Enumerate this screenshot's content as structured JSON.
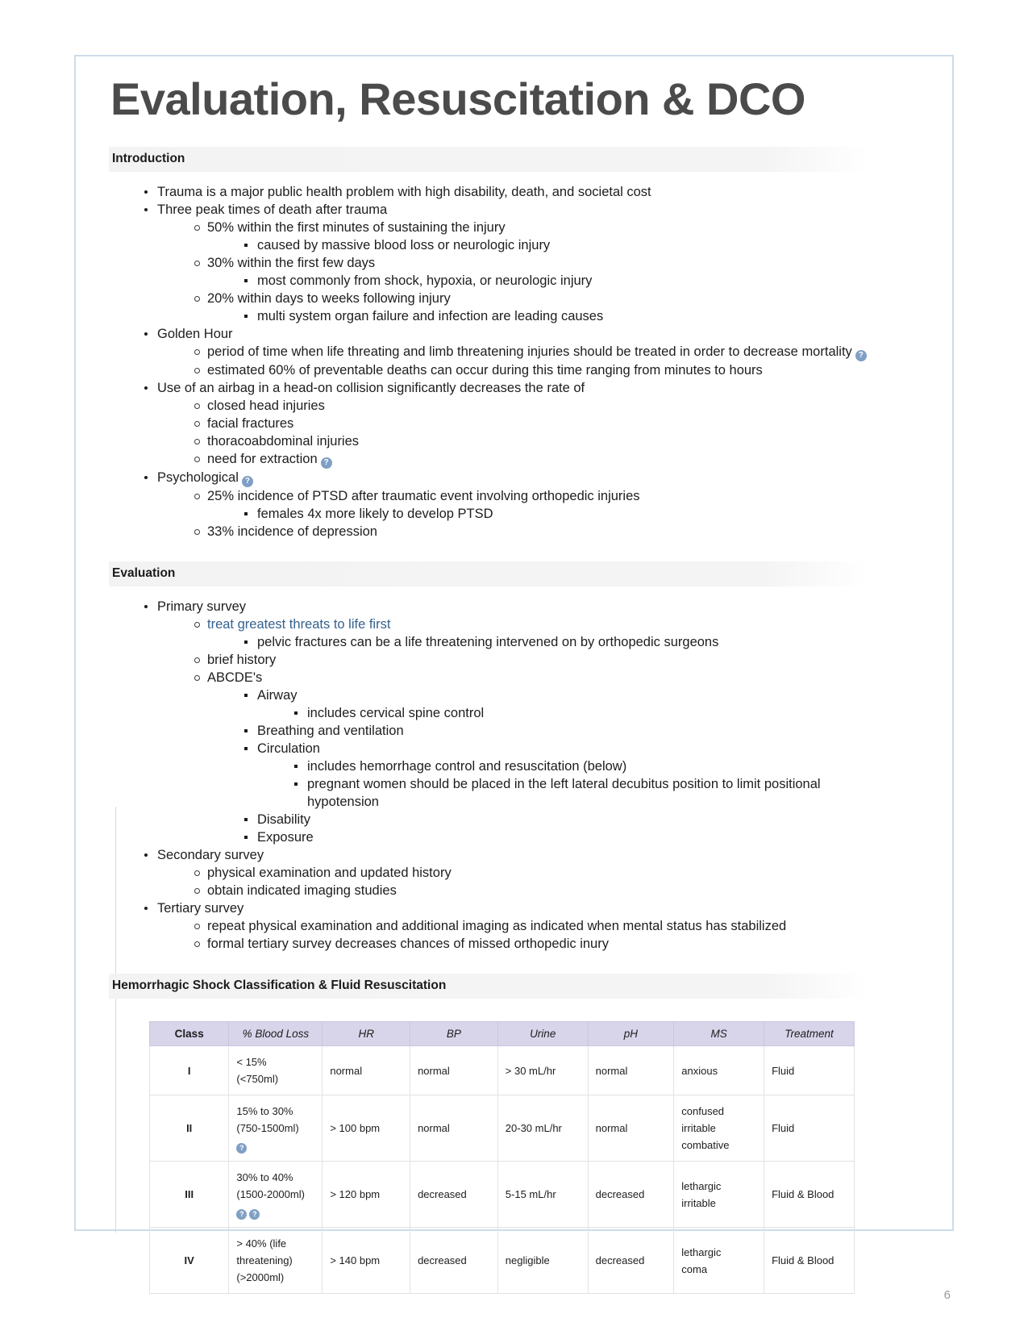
{
  "document": {
    "title": "Evaluation, Resuscitation & DCO",
    "page_number": "6"
  },
  "sections": [
    {
      "heading": "Introduction",
      "items": [
        {
          "level": 1,
          "text": "Trauma is a major public health problem with high disability, death, and societal cost"
        },
        {
          "level": 1,
          "text": "Three peak times of death after trauma"
        },
        {
          "level": 2,
          "text": "50% within the first minutes of sustaining the injury"
        },
        {
          "level": 3,
          "text": "caused by massive blood loss or neurologic injury"
        },
        {
          "level": 2,
          "text": "30% within the first few days"
        },
        {
          "level": 3,
          "text": "most commonly from shock, hypoxia, or neurologic injury"
        },
        {
          "level": 2,
          "text": "20% within days to weeks following injury"
        },
        {
          "level": 3,
          "text": "multi system organ failure and infection are leading causes"
        },
        {
          "level": 1,
          "text": "Golden Hour"
        },
        {
          "level": 2,
          "text": "period of time when life threating and limb threatening injuries should be treated in order to decrease mortality",
          "help": 1
        },
        {
          "level": 2,
          "text": "estimated 60% of preventable deaths can occur during this time ranging from minutes to hours"
        },
        {
          "level": 1,
          "text": "Use of an airbag in a head-on collision significantly decreases the rate of"
        },
        {
          "level": 2,
          "text": "closed head injuries"
        },
        {
          "level": 2,
          "text": "facial fractures"
        },
        {
          "level": 2,
          "text": "thoracoabdominal injuries"
        },
        {
          "level": 2,
          "text": "need for extraction",
          "help": 1
        },
        {
          "level": 1,
          "text": "Psychological",
          "help": 1
        },
        {
          "level": 2,
          "text": "25% incidence of PTSD after traumatic event involving orthopedic injuries"
        },
        {
          "level": 3,
          "text": "females 4x more likely to develop PTSD"
        },
        {
          "level": 2,
          "text": "33% incidence of depression"
        }
      ]
    },
    {
      "heading": "Evaluation",
      "items": [
        {
          "level": 1,
          "text": "Primary survey"
        },
        {
          "level": 2,
          "text": "treat greatest threats to life first",
          "link": true
        },
        {
          "level": 3,
          "text": "pelvic fractures can be a life threatening intervened on by orthopedic surgeons"
        },
        {
          "level": 2,
          "text": "brief history"
        },
        {
          "level": 2,
          "text": "ABCDE's"
        },
        {
          "level": 3,
          "text": "Airway"
        },
        {
          "level": 4,
          "text": "includes cervical spine control"
        },
        {
          "level": 3,
          "text": "Breathing and ventilation"
        },
        {
          "level": 3,
          "text": "Circulation"
        },
        {
          "level": 4,
          "text": "includes hemorrhage control and resuscitation (below)"
        },
        {
          "level": 4,
          "text": "pregnant women should be placed in the left lateral decubitus position to limit positional hypotension"
        },
        {
          "level": 3,
          "text": "Disability"
        },
        {
          "level": 3,
          "text": "Exposure"
        },
        {
          "level": 1,
          "text": "Secondary survey"
        },
        {
          "level": 2,
          "text": "physical examination and updated history"
        },
        {
          "level": 2,
          "text": "obtain indicated imaging studies"
        },
        {
          "level": 1,
          "text": "Tertiary survey"
        },
        {
          "level": 2,
          "text": "repeat physical examination and additional imaging as indicated when mental status has stabilized"
        },
        {
          "level": 2,
          "text": "formal tertiary survey decreases chances of missed orthopedic inury"
        }
      ]
    }
  ],
  "table_section": {
    "heading": "Hemorrhagic Shock Classification & Fluid Resuscitation",
    "columns": [
      "Class",
      "% Blood Loss",
      "HR",
      "BP",
      "Urine",
      "pH",
      "MS",
      "Treatment"
    ],
    "rows": [
      {
        "class": "I",
        "blood_loss_lines": [
          "< 15%",
          "(<750ml)"
        ],
        "help_count": 0,
        "hr": "normal",
        "bp": "normal",
        "urine": "> 30 mL/hr",
        "ph": "normal",
        "ms_lines": [
          "anxious"
        ],
        "treatment": "Fluid"
      },
      {
        "class": "II",
        "blood_loss_lines": [
          "15% to 30%",
          "(750-1500ml)"
        ],
        "help_count": 1,
        "hr": "> 100 bpm",
        "bp": "normal",
        "urine": "20-30 mL/hr",
        "ph": "normal",
        "ms_lines": [
          "confused",
          "irritable",
          "combative"
        ],
        "treatment": "Fluid"
      },
      {
        "class": "III",
        "blood_loss_lines": [
          "30% to 40%",
          "(1500-2000ml)"
        ],
        "help_count": 2,
        "hr": "> 120 bpm",
        "bp": "decreased",
        "urine": "5-15 mL/hr",
        "ph": "decreased",
        "ms_lines": [
          "lethargic",
          "irritable"
        ],
        "treatment": "Fluid & Blood"
      },
      {
        "class": "IV",
        "blood_loss_lines": [
          "> 40% (life",
          "threatening)",
          "(>2000ml)"
        ],
        "help_count": 0,
        "hr": "> 140 bpm",
        "bp": "decreased",
        "urine": "negligible",
        "ph": "decreased",
        "ms_lines": [
          "lethargic",
          "coma"
        ],
        "treatment": "Fluid & Blood"
      }
    ]
  },
  "icons": {
    "help_glyph": "?",
    "help_color": "#7f9fc4"
  }
}
